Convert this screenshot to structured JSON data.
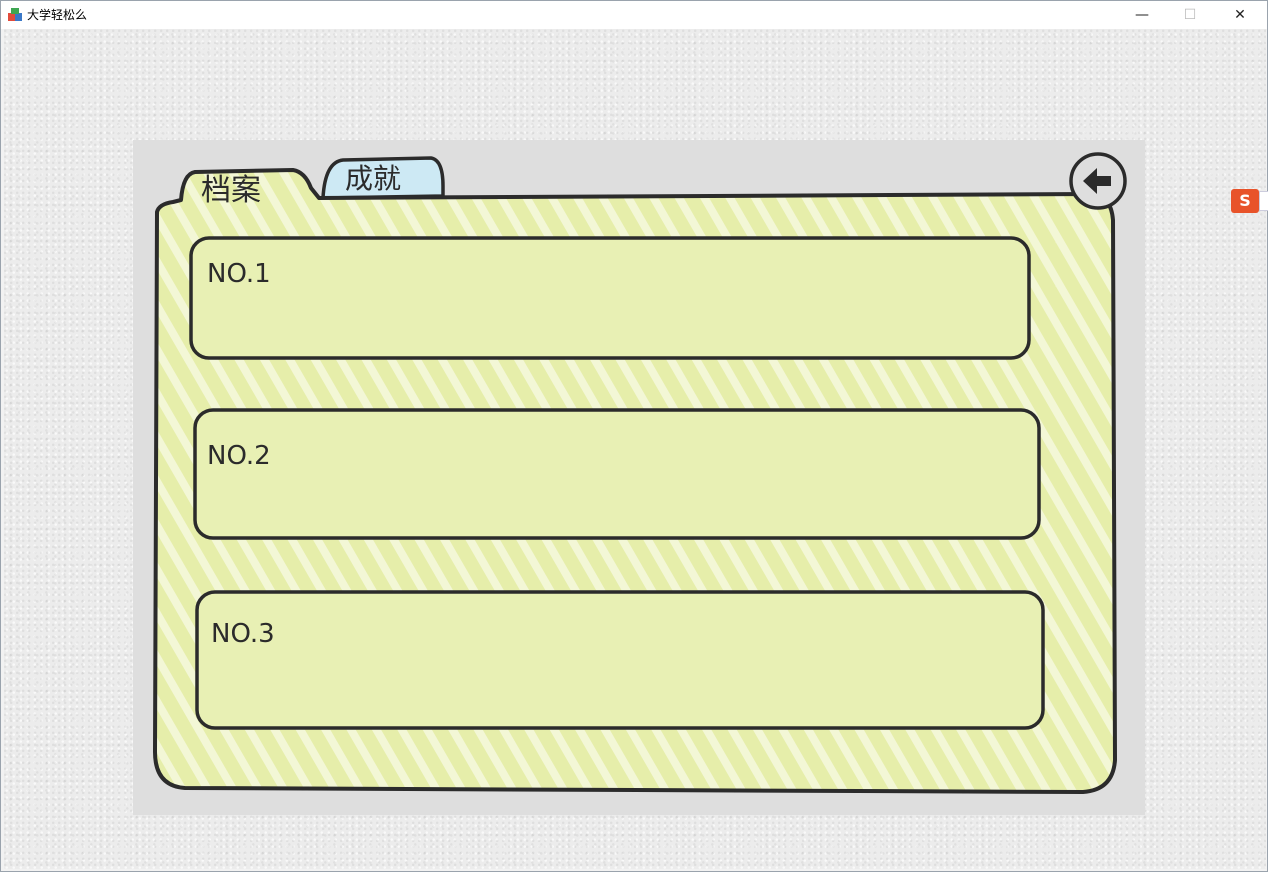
{
  "window": {
    "title": "大学轻松么",
    "minimize_glyph": "—",
    "maximize_glyph": "☐",
    "close_glyph": "✕"
  },
  "tabs": [
    {
      "label": "档案",
      "active": true
    },
    {
      "label": "成就",
      "active": false
    }
  ],
  "back_icon": "arrow-left-icon",
  "slots": [
    {
      "label": "NO.1"
    },
    {
      "label": "NO.2"
    },
    {
      "label": "NO.3"
    }
  ],
  "ime": {
    "label": "S"
  },
  "colors": {
    "folder_fill": "#e6eeaa",
    "slot_fill": "#e8f0b4",
    "tab_inactive": "#cde9f4",
    "ink": "#2b2b2b"
  }
}
